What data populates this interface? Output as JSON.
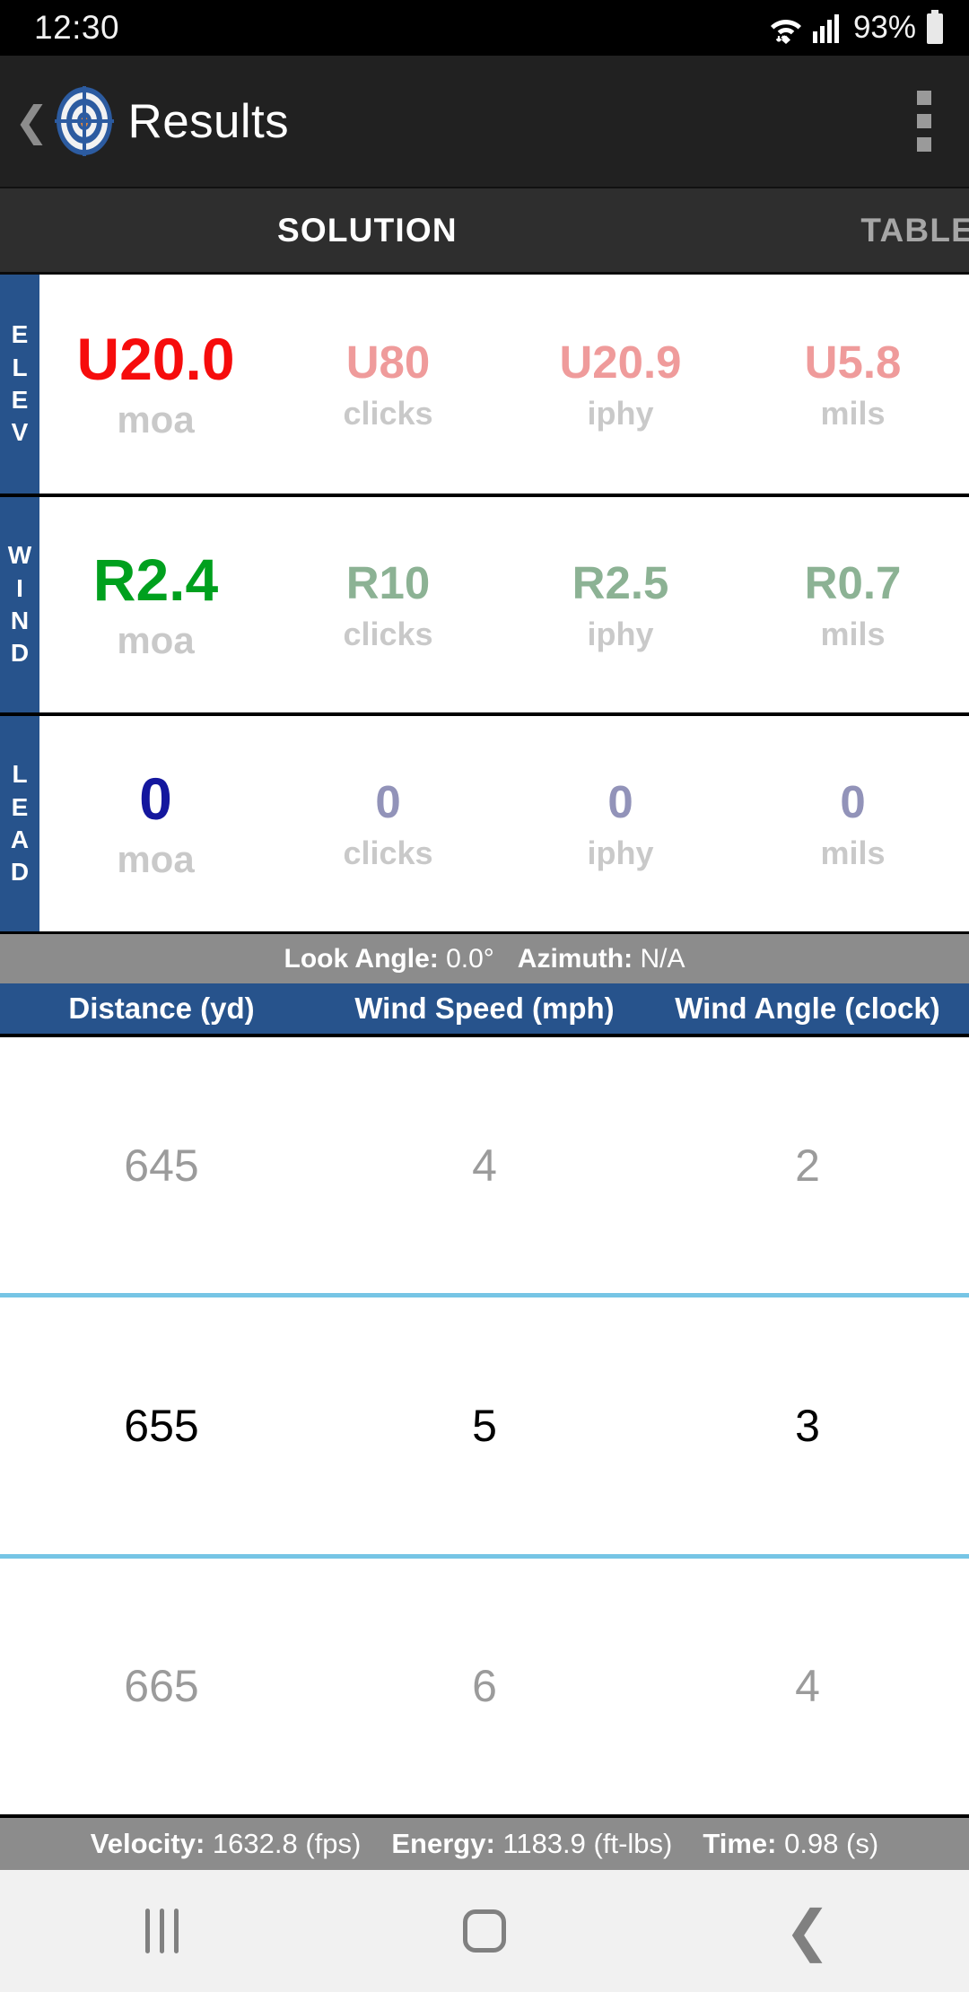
{
  "status_bar": {
    "clock": "12:30",
    "battery_percent": "93%",
    "icons": [
      "wifi-icon",
      "cellular-signal-icon",
      "battery-icon"
    ]
  },
  "action_bar": {
    "back_icon": "back-chevron-icon",
    "logo_icon": "target-crosshair-logo-icon",
    "title": "Results",
    "overflow_icon": "overflow-menu-icon"
  },
  "tabs": [
    {
      "label": "SOLUTION",
      "active": true
    },
    {
      "label": "TABLE",
      "active": false
    }
  ],
  "solution": {
    "units": [
      "moa",
      "clicks",
      "iphy",
      "mils"
    ],
    "rows": [
      {
        "label": "ELEV",
        "label_letters": [
          "E",
          "L",
          "E",
          "V"
        ],
        "primary_color": "#f60c0c",
        "secondary_color": "#ef9b9b",
        "values": [
          "U20.0",
          "U80",
          "U20.9",
          "U5.8"
        ]
      },
      {
        "label": "WIND",
        "label_letters": [
          "W",
          "I",
          "N",
          "D"
        ],
        "primary_color": "#00a01e",
        "secondary_color": "#8cb294",
        "values": [
          "R2.4",
          "R10",
          "R2.5",
          "R0.7"
        ]
      },
      {
        "label": "LEAD",
        "label_letters": [
          "L",
          "E",
          "A",
          "D"
        ],
        "primary_color": "#14179e",
        "secondary_color": "#9293b9",
        "values": [
          "0",
          "0",
          "0",
          "0"
        ]
      }
    ]
  },
  "info_bar": {
    "look_angle_label": "Look Angle:",
    "look_angle_value": "0.0°",
    "azimuth_label": "Azimuth:",
    "azimuth_value": "N/A"
  },
  "table": {
    "headers": [
      "Distance (yd)",
      "Wind Speed (mph)",
      "Wind Angle (clock)"
    ],
    "rows": [
      {
        "cells": [
          "645",
          "4",
          "2"
        ],
        "selected": false
      },
      {
        "cells": [
          "655",
          "5",
          "3"
        ],
        "selected": true
      },
      {
        "cells": [
          "665",
          "6",
          "4"
        ],
        "selected": false
      }
    ]
  },
  "stat_bar": {
    "velocity_label": "Velocity:",
    "velocity_value": "1632.8 (fps)",
    "energy_label": "Energy:",
    "energy_value": "1183.9 (ft-lbs)",
    "time_label": "Time:",
    "time_value": "0.98 (s)"
  },
  "nav_bar": {
    "recents_icon": "recents-icon",
    "home_icon": "home-icon",
    "back_icon": "back-icon"
  },
  "colors": {
    "brand_blue": "#27538c",
    "accent_row_highlight": "#76c5e5",
    "bar_gray": "#8c8c8c",
    "elev_red": "#f60c0c",
    "wind_green": "#00a01e",
    "lead_navy": "#14179e"
  }
}
